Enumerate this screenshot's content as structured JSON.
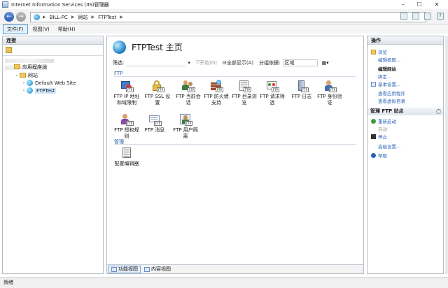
{
  "window": {
    "title": "Internet Information Services (IIS)管理器"
  },
  "address": {
    "crumbs": [
      "BILL-PC",
      "网站",
      "FTPTest"
    ]
  },
  "menu": {
    "items": [
      "文件(F)",
      "视图(V)",
      "帮助(H)"
    ]
  },
  "connections": {
    "header": "连接",
    "tree": {
      "pools": "应用程序池",
      "sites": "网站",
      "default_site": "Default Web Site",
      "ftp_site": "FTPTest"
    }
  },
  "content": {
    "title": "FTPTest 主页",
    "filter_label": "筛选:",
    "start_label": "开始(G)",
    "show_all_label": "全部显示(A)",
    "group_label": "分组依据:",
    "group_value": "区域",
    "section_ftp": "FTP",
    "section_manage": "管理",
    "features": [
      "FTP IP 地址和域限制",
      "FTP SSL 设置",
      "FTP 当前会话",
      "FTP 防火墙支持",
      "FTP 目录浏览",
      "FTP 请求筛选",
      "FTP 日志",
      "FTP 身份验证",
      "FTP 授权规则",
      "FTP 消息",
      "FTP 用户隔离"
    ],
    "manage_features": [
      "配置编辑器"
    ],
    "tabs": [
      "功能视图",
      "内容视图"
    ]
  },
  "actions": {
    "header": "操作",
    "browse": "浏览",
    "edit_perms": "编辑权限...",
    "edit_site_heading": "编辑网站",
    "bindings": "绑定...",
    "basic_settings": "基本设置...",
    "view_apps": "查看应用程序",
    "view_vdirs": "查看虚拟目录",
    "manage_group": "管理 FTP 站点",
    "restart": "重新启动",
    "start": "启动",
    "stop": "停止",
    "advanced": "高级设置...",
    "help": "帮助"
  },
  "status": {
    "text": "就绪"
  },
  "colors": {
    "link": "#2a63b7",
    "section": "#1e5fa9",
    "selected": "#cce8ff"
  }
}
